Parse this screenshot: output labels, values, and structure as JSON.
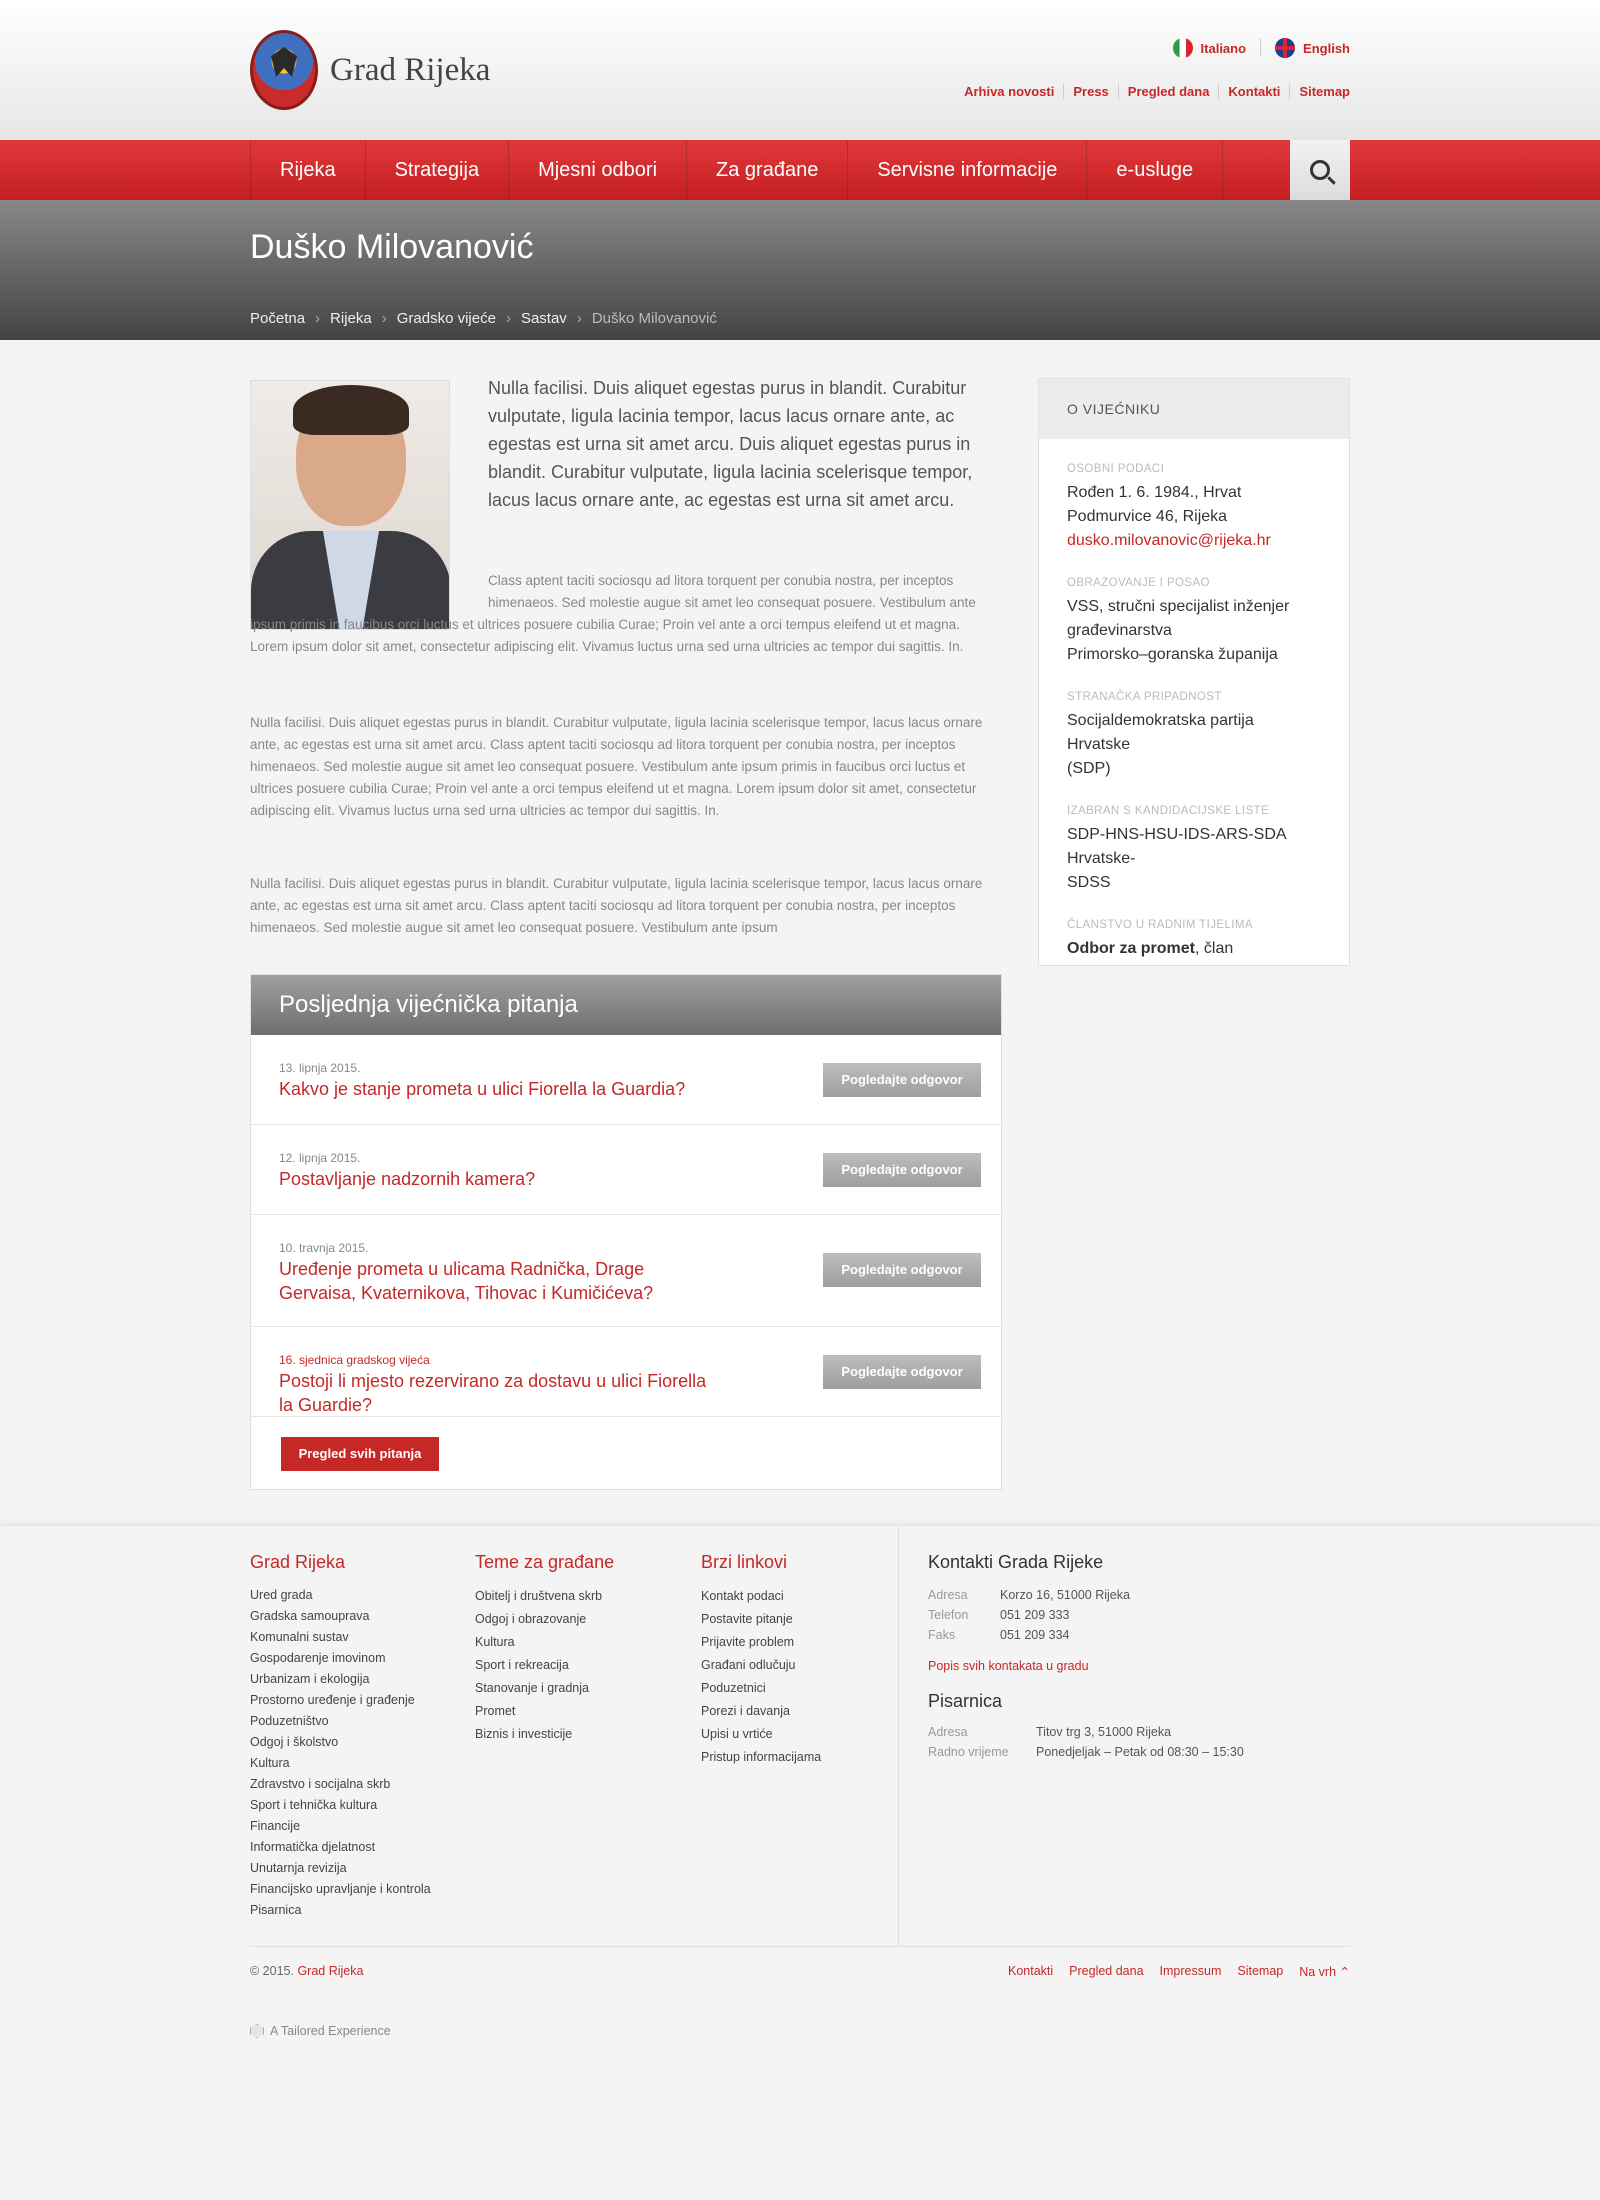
{
  "header": {
    "site_name": "Grad Rijeka",
    "languages": [
      "Italiano",
      "English"
    ],
    "top_links": [
      "Arhiva novosti",
      "Press",
      "Pregled dana",
      "Kontakti",
      "Sitemap"
    ]
  },
  "nav": {
    "items": [
      "Rijeka",
      "Strategija",
      "Mjesni odbori",
      "Za građane",
      "Servisne informacije",
      "e-usluge"
    ]
  },
  "page": {
    "title": "Duško Milovanović",
    "breadcrumb": [
      "Početna",
      "Rijeka",
      "Gradsko vijeće",
      "Sastav",
      "Duško Milovanović"
    ]
  },
  "content": {
    "lead": "Nulla facilisi. Duis aliquet egestas purus in blandit. Curabitur vulputate, ligula lacinia tempor, lacus lacus ornare ante, ac egestas est urna sit amet arcu. Duis aliquet egestas purus in blandit. Curabitur vulputate, ligula lacinia scelerisque tempor, lacus lacus ornare ante, ac egestas est urna sit amet arcu.",
    "p1": "Class aptent taciti sociosqu ad litora torquent per conubia nostra, per inceptos himenaeos. Sed molestie augue sit amet leo consequat posuere. Vestibulum ante ipsum primis in faucibus orci luctus et ultrices posuere cubilia Curae; Proin vel ante a orci tempus eleifend ut et magna. Lorem ipsum dolor sit amet, consectetur adipiscing elit. Vivamus luctus urna sed urna ultricies ac tempor dui sagittis. In.",
    "p2": "Nulla facilisi. Duis aliquet egestas purus in blandit. Curabitur vulputate, ligula lacinia scelerisque tempor, lacus lacus ornare ante, ac egestas est urna sit amet arcu. Class aptent taciti sociosqu ad litora torquent per conubia nostra, per inceptos himenaeos. Sed molestie augue sit amet leo consequat posuere. Vestibulum ante ipsum primis in faucibus orci luctus et ultrices posuere cubilia Curae; Proin vel ante a orci tempus eleifend ut et magna. Lorem ipsum dolor sit amet, consectetur adipiscing elit. Vivamus luctus urna sed urna ultricies ac tempor dui sagittis. In.",
    "p3": "Nulla facilisi. Duis aliquet egestas purus in blandit. Curabitur vulputate, ligula lacinia scelerisque tempor, lacus lacus ornare ante, ac egestas est urna sit amet arcu. Class aptent taciti sociosqu ad litora torquent per conubia nostra, per inceptos himenaeos. Sed molestie augue sit amet leo consequat posuere. Vestibulum ante ipsum"
  },
  "questions": {
    "heading": "Posljednja vijećnička pitanja",
    "button_label": "Pogledajte odgovor",
    "items": [
      {
        "date": "13. lipnja 2015.",
        "title": "Kakvo je stanje prometa u ulici Fiorella la Guardia?"
      },
      {
        "date": "12. lipnja 2015.",
        "title": "Postavljanje nadzornih kamera?"
      },
      {
        "date": "10. travnja 2015.",
        "title": "Uređenje prometa u ulicama Radnička, Drage Gervaisa, Kvaternikova, Tihovac i Kumičićeva?"
      },
      {
        "date": "16. sjednica gradskog vijeća",
        "title": "Postoji li mjesto rezervirano za dostavu u ulici Fiorella la Guardie?"
      }
    ],
    "all_label": "Pregled svih pitanja"
  },
  "sidebar": {
    "heading": "O VIJEĆNIKU",
    "sections": {
      "personal_label": "OSOBNI PODACI",
      "personal_line1": "Rođen 1. 6. 1984., Hrvat",
      "personal_line2": "Podmurvice 46, Rijeka",
      "email": "dusko.milovanovic@rijeka.hr",
      "edu_label": "OBRAZOVANJE I POSAO",
      "edu_line1": "VSS, stručni specijalist inženjer",
      "edu_line2": "građevinarstva",
      "edu_line3": "Primorsko–goranska županija",
      "party_label": "STRANAČKA PRIPADNOST",
      "party_line1": "Socijaldemokratska partija Hrvatske",
      "party_line2": "(SDP)",
      "list_label": "IZABRAN S KANDIDACIJSKE LISTE",
      "list_line1": "SDP-HNS-HSU-IDS-ARS-SDA Hrvatske-",
      "list_line2": "SDSS",
      "bodies_label": "ČLANSTVO U RADNIM TIJELIMA",
      "body_name": "Odbor za promet",
      "body_role": ", član"
    }
  },
  "footer": {
    "col1_title": "Grad Rijeka",
    "col1_items": [
      "Ured grada",
      "Gradska samouprava",
      "Komunalni sustav",
      "Gospodarenje imovinom",
      "Urbanizam i ekologija",
      "Prostorno uređenje i građenje",
      "Poduzetništvo",
      "Odgoj i školstvo",
      "Kultura",
      "Zdravstvo i socijalna skrb",
      "Sport i tehnička kultura",
      "Financije",
      "Informatička djelatnost",
      "Unutarnja revizija",
      "Financijsko upravljanje i kontrola",
      "Pisarnica"
    ],
    "col2_title": "Teme za građane",
    "col2_items": [
      "Obitelj i društvena skrb",
      "Odgoj i obrazovanje",
      "Kultura",
      "Sport i rekreacija",
      "Stanovanje i gradnja",
      "Promet",
      "Biznis i investicije"
    ],
    "col3_title": "Brzi linkovi",
    "col3_items": [
      "Kontakt podaci",
      "Postavite pitanje",
      "Prijavite problem",
      "Građani odlučuju",
      "Poduzetnici",
      "Porezi i davanja",
      "Upisi u vrtiće",
      "Pristup informacijama"
    ],
    "contacts_title": "Kontakti Grada Rijeke",
    "contacts": [
      {
        "key": "Adresa",
        "val": "Korzo 16, 51000 Rijeka"
      },
      {
        "key": "Telefon",
        "val": "051 209 333"
      },
      {
        "key": "Faks",
        "val": "051 209 334"
      }
    ],
    "contacts_link": "Popis svih kontakata u gradu",
    "office_title": "Pisarnica",
    "office": [
      {
        "key": "Adresa",
        "val": "Titov trg 3, 51000 Rijeka"
      },
      {
        "key": "Radno vrijeme",
        "val": "Ponedjeljak – Petak od 08:30 – 15:30"
      }
    ],
    "copyright_prefix": "© 2015.",
    "copyright_link": "Grad Rijeka",
    "links": [
      "Kontakti",
      "Pregled dana",
      "Impressum",
      "Sitemap",
      "Na vrh ⌃"
    ],
    "tailored": "A Tailored Experience"
  },
  "colors": {
    "accent": "#c62828",
    "nav": "#d32f2f"
  }
}
